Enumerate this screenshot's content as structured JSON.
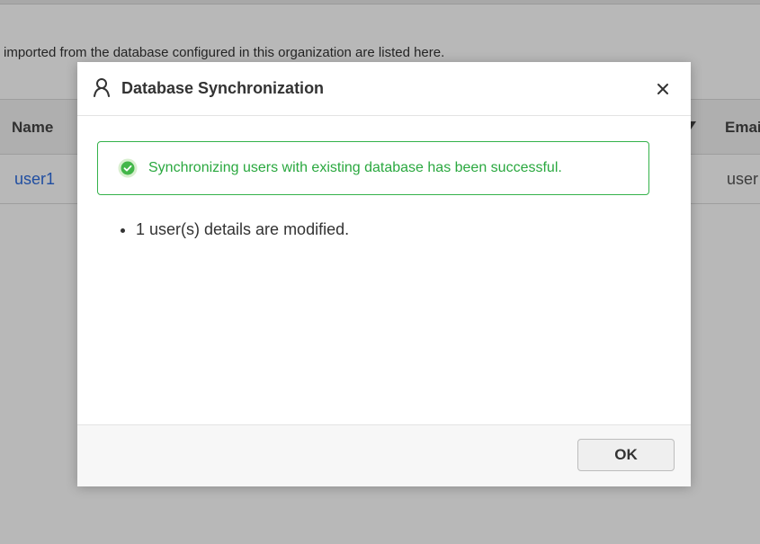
{
  "background": {
    "description": "imported from the database configured in this organization are listed here.",
    "table": {
      "columns": [
        "Name",
        "Emai"
      ],
      "rows": [
        {
          "name": "user1",
          "email": "user"
        }
      ]
    }
  },
  "dialog": {
    "title": "Database Synchronization",
    "title_icon": "user-icon",
    "close_icon": "close-icon",
    "alert": {
      "icon": "check-circle-icon",
      "message": "Synchronizing users with existing database has been successful.",
      "color": "#2aa83f"
    },
    "results": [
      "1 user(s) details are modified."
    ],
    "ok_label": "OK"
  },
  "colors": {
    "success": "#2aa83f",
    "link": "#2d6cdf"
  }
}
